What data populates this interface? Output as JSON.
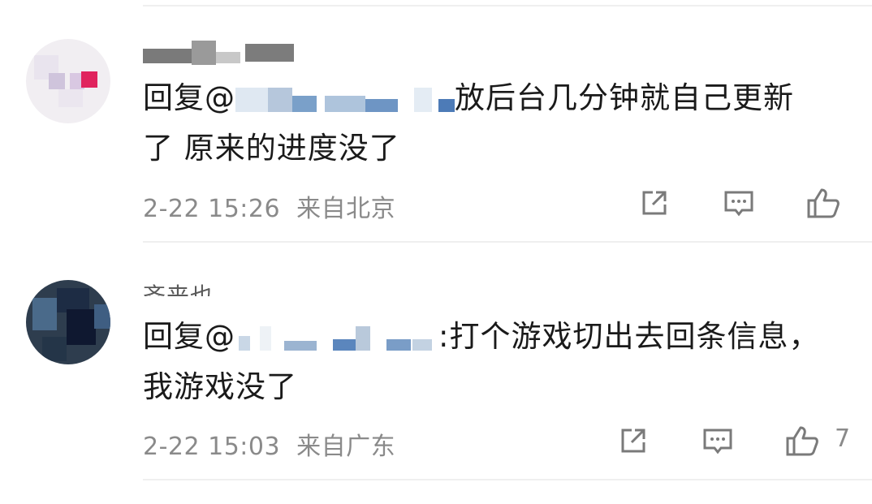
{
  "comments": [
    {
      "text_prefix": "回复@",
      "text_rest": "放后台几分钟就自己更新",
      "text_line2": "了 原来的进度没了",
      "date": "2-22 15:26",
      "location": "来自北京",
      "likes": ""
    },
    {
      "handle_fragment": "齐来也",
      "text_prefix": "回复@",
      "text_rest": ":打个游戏切出去回条信息，",
      "text_line2": "我游戏没了",
      "date": "2-22 15:03",
      "location": "来自广东",
      "likes": "7"
    }
  ],
  "icons": {
    "share": "share-icon",
    "comment": "comment-icon",
    "like": "thumbs-up-icon"
  },
  "colors": {
    "meta_text": "#8a8a8a",
    "body_text": "#1a1a1a",
    "redact_blue": "#5b86bd"
  }
}
